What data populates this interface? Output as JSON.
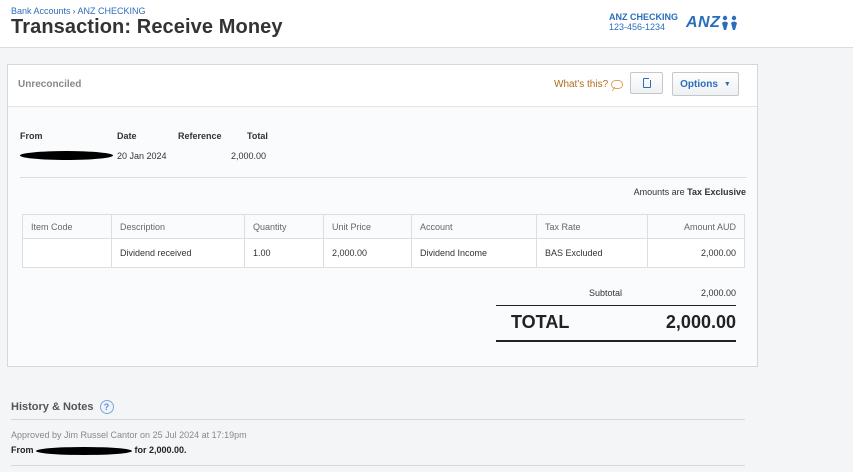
{
  "breadcrumb": {
    "items": [
      "Bank Accounts",
      "ANZ CHECKING"
    ],
    "separator": "›"
  },
  "title": "Transaction: Receive Money",
  "account": {
    "name": "ANZ CHECKING",
    "number": "123-456-1234"
  },
  "logo": {
    "text": "ANZ",
    "icon": "anz-people-icon"
  },
  "toolbar": {
    "status": "Unreconciled",
    "whats_this": "What's this?",
    "copy_icon": "document-copy-icon",
    "options_label": "Options",
    "options_caret": "▼"
  },
  "header_fields": {
    "from_label": "From",
    "date_label": "Date",
    "date_value": "20 Jan 2024",
    "reference_label": "Reference",
    "reference_value": "",
    "total_label": "Total",
    "total_value": "2,000.00"
  },
  "tax_note": {
    "prefix": "Amounts are",
    "mode": "Tax Exclusive"
  },
  "line_items": {
    "columns": [
      "Item Code",
      "Description",
      "Quantity",
      "Unit Price",
      "Account",
      "Tax Rate",
      "Amount AUD"
    ],
    "rows": [
      {
        "item_code": "",
        "description": "Dividend received",
        "quantity": "1.00",
        "unit_price": "2,000.00",
        "account": "Dividend Income",
        "tax_rate": "BAS Excluded",
        "amount": "2,000.00"
      }
    ]
  },
  "totals": {
    "subtotal_label": "Subtotal",
    "subtotal_value": "2,000.00",
    "total_label": "TOTAL",
    "total_value": "2,000.00"
  },
  "history": {
    "title": "History & Notes",
    "help_icon": "?",
    "approved_text": "Approved by Jim Russel Cantor on 25 Jul 2024 at 17:19pm",
    "from_prefix": "From",
    "from_suffix": "for 2,000.00."
  },
  "colors": {
    "link": "#2a6ebb",
    "whats_this": "#b36b1e",
    "redaction": "#000000"
  }
}
